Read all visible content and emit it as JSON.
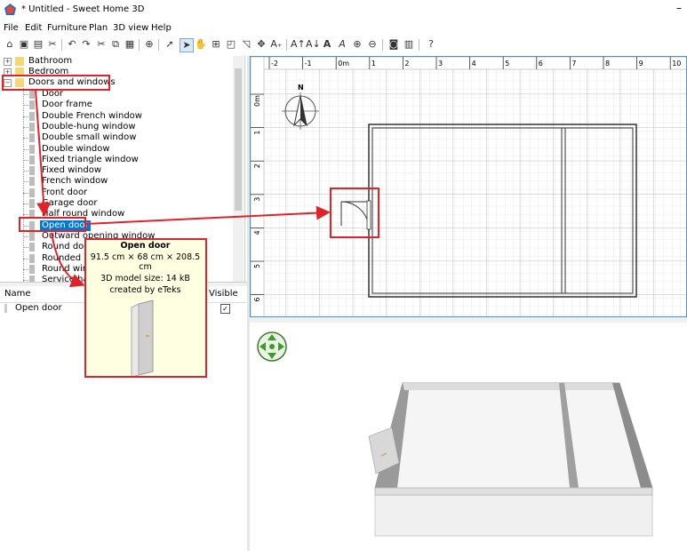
{
  "window": {
    "title": "* Untitled - Sweet Home 3D",
    "minimize": "–"
  },
  "menu": [
    "File",
    "Edit",
    "Furniture",
    "Plan",
    "3D view",
    "Help"
  ],
  "catalog": {
    "categories": [
      "Bathroom",
      "Bedroom",
      "Doors and windows"
    ],
    "items": [
      "Door",
      "Door frame",
      "Double French window",
      "Double-hung window",
      "Double small window",
      "Double window",
      "Fixed triangle window",
      "Fixed window",
      "French window",
      "Front door",
      "Garage door",
      "Half round window",
      "Open door",
      "Outward opening window",
      "Round door",
      "Rounded door",
      "Round window",
      "Service hatch"
    ],
    "selected": "Open door"
  },
  "tooltip": {
    "name": "Open door",
    "dimensions": "91.5 cm × 68 cm × 208.5 cm",
    "model_size": "3D model size: 14 kB",
    "creator": "created by eTeks"
  },
  "furniture_table": {
    "columns": [
      "Name",
      "Visible"
    ],
    "rows": [
      {
        "name": "Open door",
        "visible": true
      }
    ]
  },
  "plan": {
    "x_ruler": [
      "-2",
      "-1",
      "0m",
      "1",
      "2",
      "3",
      "4",
      "5",
      "6",
      "7",
      "8",
      "9",
      "10"
    ],
    "y_ruler": [
      "0m",
      "1",
      "2",
      "3",
      "4",
      "5",
      "6"
    ],
    "compass_label": "N"
  },
  "colors": {
    "annotation": "#e0222b",
    "selection": "#0078d7",
    "tooltip_bg": "#ffffe1",
    "plan_border": "#4a90d9"
  }
}
